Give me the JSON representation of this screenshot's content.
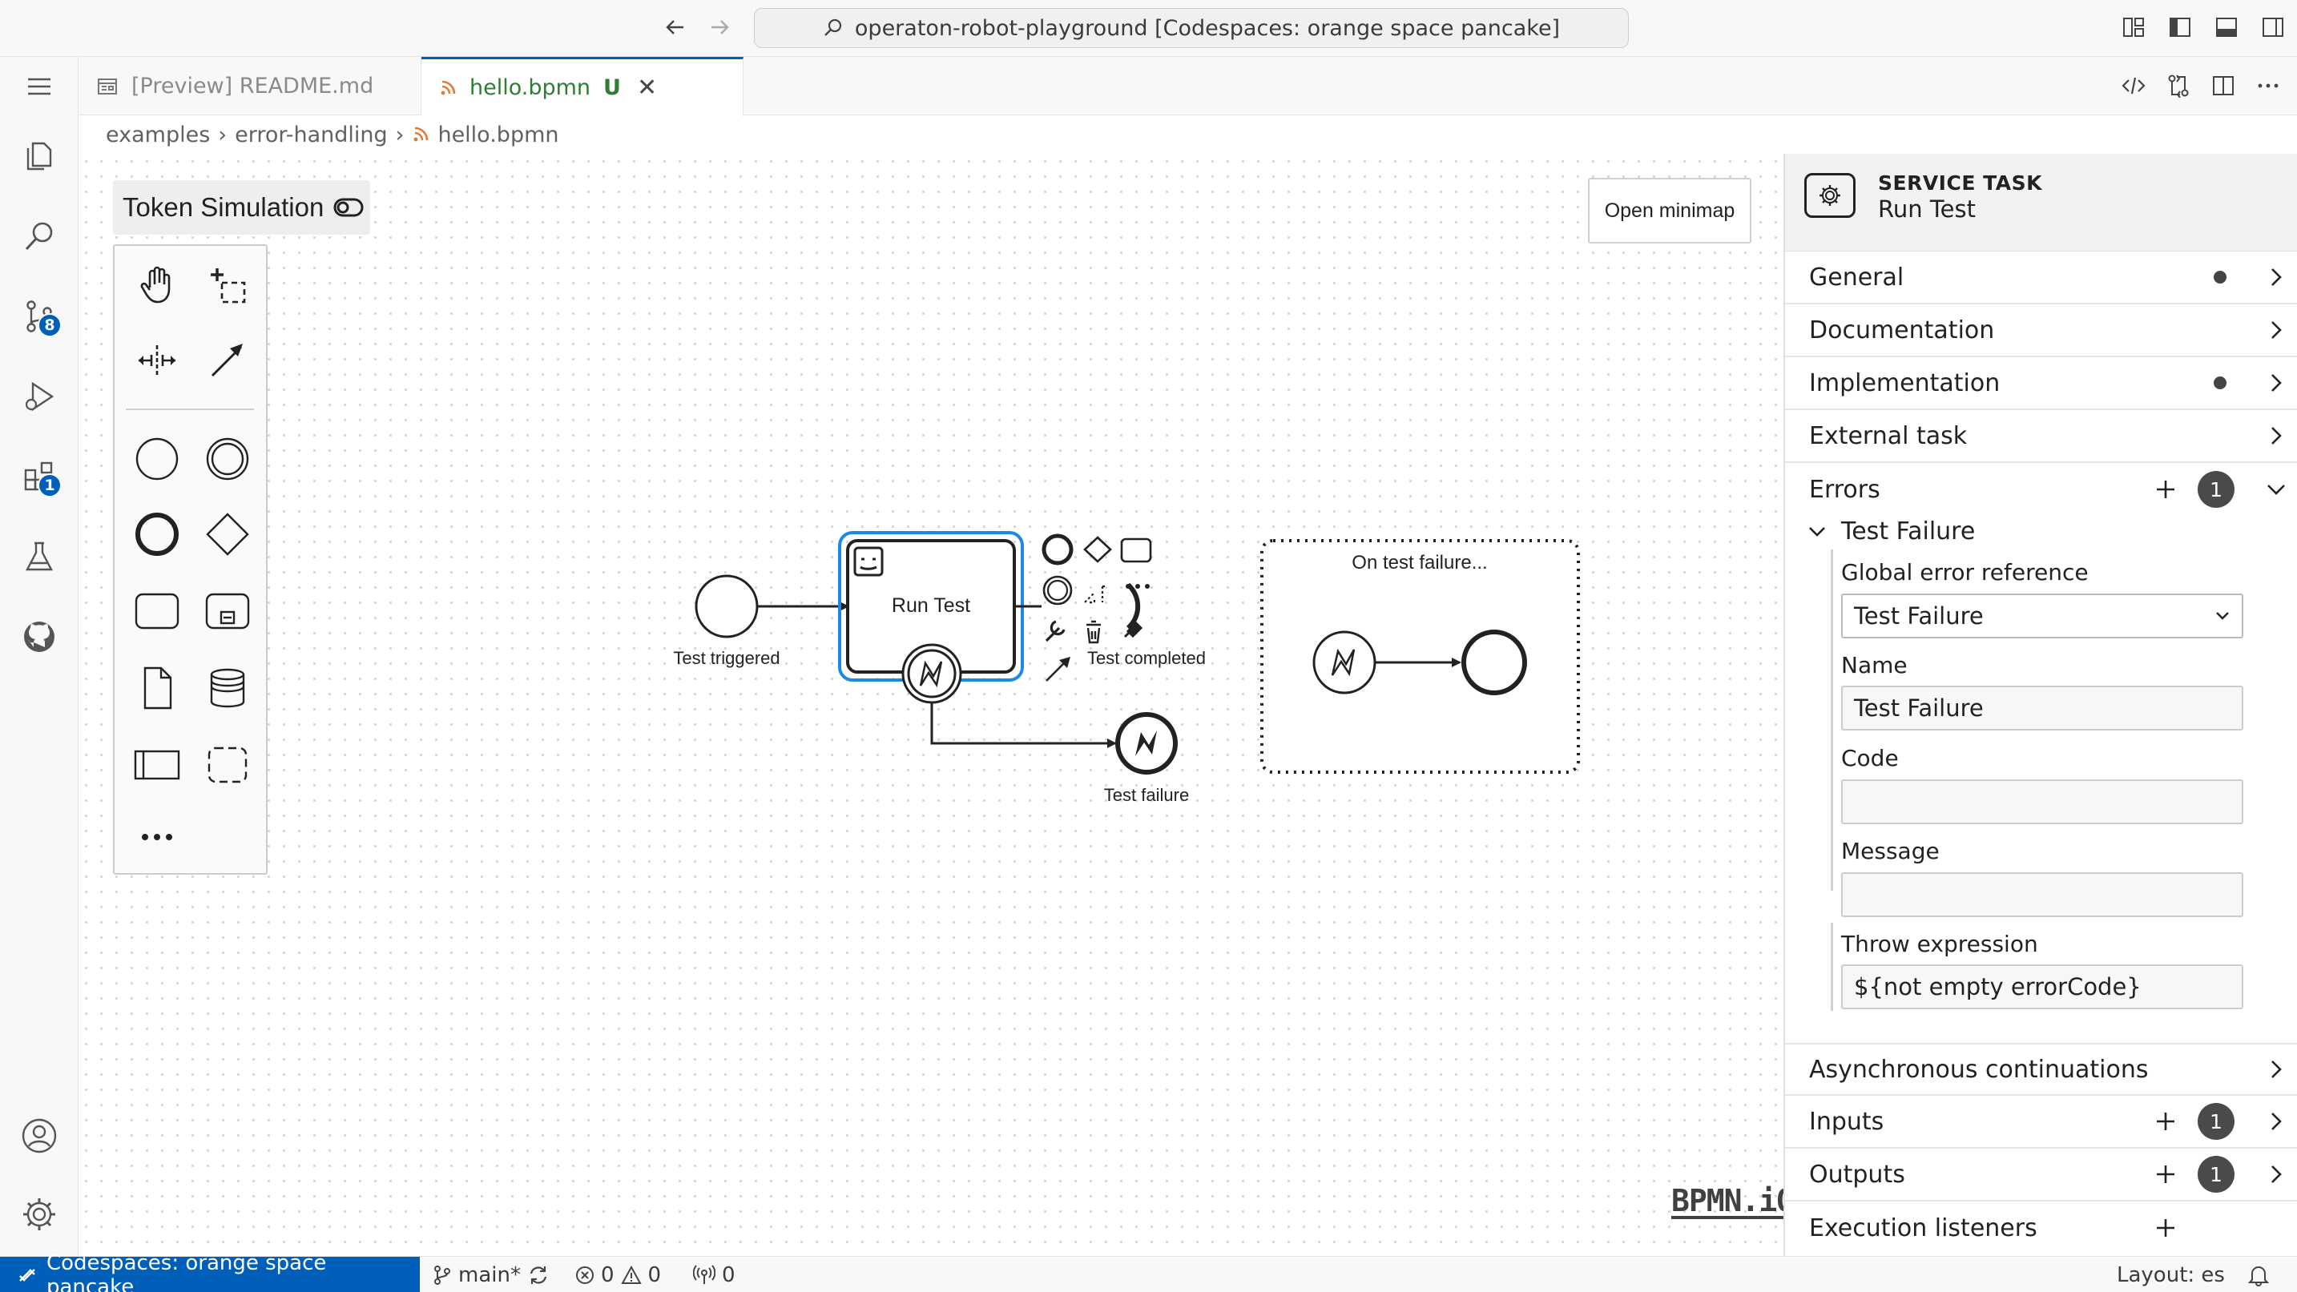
{
  "titlebar": {
    "search_text": "operaton-robot-playground [Codespaces: orange space pancake]"
  },
  "activitybar": {
    "items": [
      {
        "name": "explorer"
      },
      {
        "name": "search"
      },
      {
        "name": "source-control",
        "badge": "8"
      },
      {
        "name": "run-debug"
      },
      {
        "name": "extensions",
        "badge": "1"
      },
      {
        "name": "testing"
      },
      {
        "name": "github"
      }
    ],
    "bottom": [
      {
        "name": "accounts"
      },
      {
        "name": "manage"
      }
    ]
  },
  "tabs": [
    {
      "label": "[Preview] README.md",
      "active": false
    },
    {
      "label": "hello.bpmn",
      "status": "U",
      "active": true
    }
  ],
  "breadcrumb": {
    "parts": [
      "examples",
      "error-handling",
      "hello.bpmn"
    ]
  },
  "canvas": {
    "token_simulation_label": "Token Simulation",
    "minimap_button": "Open minimap",
    "logo": "BPMN.iO",
    "elements": {
      "start_event_label": "Test triggered",
      "task_label": "Run Test",
      "end_event_label": "Test completed",
      "error_end_label": "Test failure",
      "subprocess_label": "On test failure..."
    }
  },
  "properties": {
    "header_type": "SERVICE TASK",
    "header_name": "Run Test",
    "groups": {
      "general": "General",
      "documentation": "Documentation",
      "implementation": "Implementation",
      "external_task": "External task",
      "errors": "Errors",
      "errors_count": "1",
      "async": "Asynchronous continuations",
      "inputs": "Inputs",
      "inputs_count": "1",
      "outputs": "Outputs",
      "outputs_count": "1",
      "execution_listeners": "Execution listeners"
    },
    "error_item": {
      "title": "Test Failure",
      "global_ref_label": "Global error reference",
      "global_ref_value": "Test Failure",
      "name_label": "Name",
      "name_value": "Test Failure",
      "code_label": "Code",
      "code_value": "",
      "message_label": "Message",
      "message_value": "",
      "throw_label": "Throw expression",
      "throw_value": "${not empty errorCode}"
    }
  },
  "statusbar": {
    "remote": "Codespaces: orange space pancake",
    "branch": "main*",
    "errors": "0",
    "warnings": "0",
    "ports": "0",
    "layout": "Layout: es"
  },
  "colors": {
    "accent": "#005fb8",
    "selection": "#1e88e5",
    "git_untracked": "#2e7d32"
  }
}
